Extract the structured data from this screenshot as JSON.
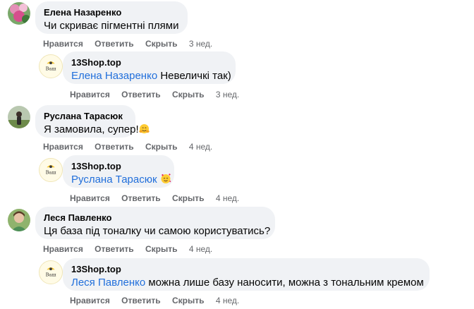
{
  "comments": [
    {
      "author": "Елена Назаренко",
      "text": "Чи скриває пігментні плями",
      "actions": {
        "like": "Нравится",
        "reply": "Ответить",
        "hide": "Скрыть",
        "time": "3 нед."
      },
      "reply": {
        "author": "13Shop.top",
        "mention": "Елена Назаренко",
        "text": " Невеличкі так)",
        "actions": {
          "like": "Нравится",
          "reply": "Ответить",
          "hide": "Скрыть",
          "time": "3 нед."
        }
      }
    },
    {
      "author": "Руслана Тарасюк",
      "text": "Я замовила, супер!",
      "actions": {
        "like": "Нравится",
        "reply": "Ответить",
        "hide": "Скрыть",
        "time": "4 нед."
      },
      "reply": {
        "author": "13Shop.top",
        "mention": "Руслана Тарасюк",
        "text": " ",
        "actions": {
          "like": "Нравится",
          "reply": "Ответить",
          "hide": "Скрыть",
          "time": "4 нед."
        }
      }
    },
    {
      "author": "Леся Павленко",
      "text": "Ця база під тоналку чи самою користуватись?",
      "actions": {
        "like": "Нравится",
        "reply": "Ответить",
        "hide": "Скрыть",
        "time": "4 нед."
      },
      "reply": {
        "author": "13Shop.top",
        "mention": "Леся Павленко",
        "text": " можна лише базу наносити, можна з тональним кремом",
        "actions": {
          "like": "Нравится",
          "reply": "Ответить",
          "hide": "Скрыть",
          "time": "4 нед."
        }
      }
    }
  ],
  "icons": {
    "hug_emoji": "hugging-face-icon",
    "love_emoji": "smiling-face-with-hearts-icon"
  },
  "colors": {
    "bubble": "#f0f2f5",
    "mention": "#216fdb",
    "meta": "#65676b"
  }
}
